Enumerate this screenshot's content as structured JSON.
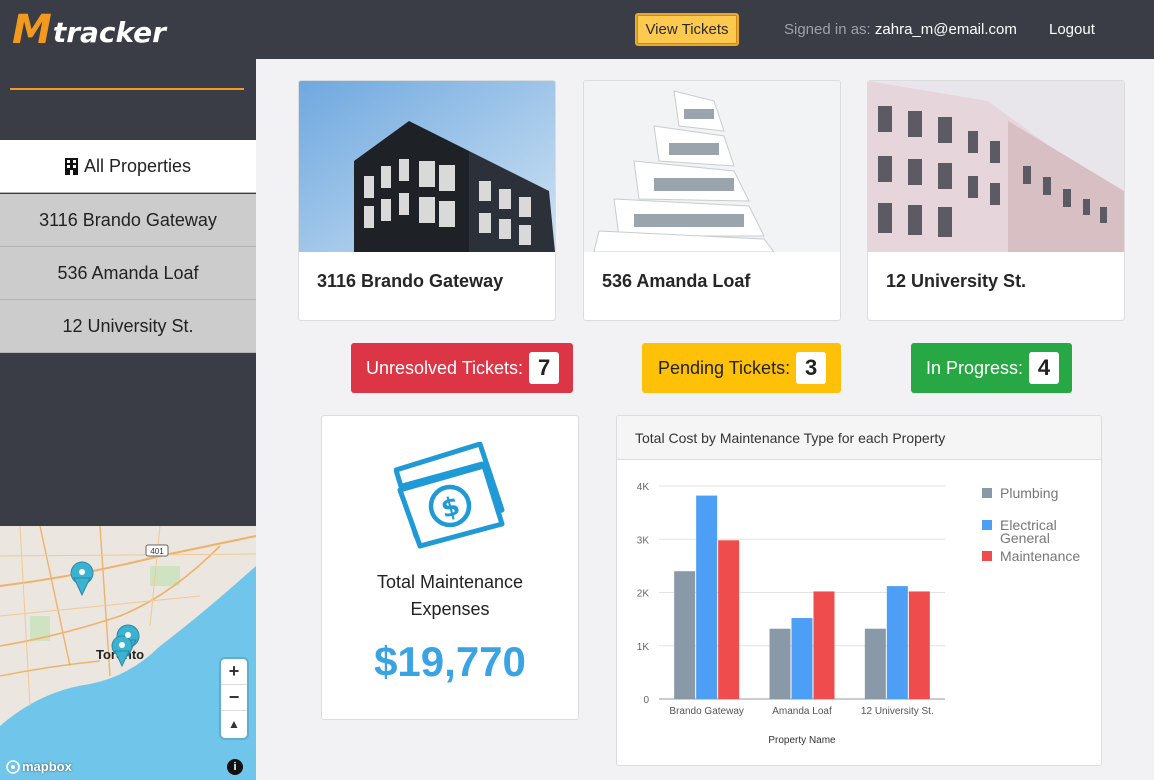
{
  "app": {
    "logo_m": "M",
    "logo_rest": "tracker",
    "view_tickets_label": "View Tickets",
    "signed_in_prefix": "Signed in as:",
    "user_email": "zahra_m@email.com",
    "logout_label": "Logout"
  },
  "sidebar": {
    "items": [
      {
        "label": "All Properties",
        "icon": "building-icon",
        "active": true
      },
      {
        "label": "3116 Brando Gateway"
      },
      {
        "label": "536 Amanda Loaf"
      },
      {
        "label": "12 University St."
      }
    ]
  },
  "map": {
    "city_label": "Toronto",
    "highway_label": "401",
    "attribution": "mapbox",
    "zoom_in": "+",
    "zoom_out": "−",
    "compass": "▲",
    "info": "i"
  },
  "properties": [
    {
      "name": "3116 Brando Gateway"
    },
    {
      "name": "536 Amanda Loaf"
    },
    {
      "name": "12 University St."
    }
  ],
  "status": {
    "unresolved_label": "Unresolved Tickets:",
    "unresolved_count": "7",
    "pending_label": "Pending Tickets:",
    "pending_count": "3",
    "inprogress_label": "In Progress:",
    "inprogress_count": "4",
    "colors": {
      "unresolved": "#dc3545",
      "pending": "#ffc107",
      "inprogress": "#28a745"
    }
  },
  "expenses": {
    "label_line1": "Total Maintenance",
    "label_line2": "Expenses",
    "value": "$19,770",
    "icon": "money-icon"
  },
  "chart_header": "Total Cost by Maintenance Type for each Property",
  "chart_data": {
    "type": "bar",
    "title": "Total Cost by Maintenance Type for each Property",
    "xlabel": "Property Name",
    "ylabel": "",
    "categories": [
      "Brando Gateway",
      "Amanda Loaf",
      "12 University St."
    ],
    "ylim": [
      0,
      4000
    ],
    "yticks": [
      "0",
      "1K",
      "2K",
      "3K",
      "4K"
    ],
    "grid": true,
    "legend_position": "right",
    "series": [
      {
        "name": "Plumbing",
        "color": "#8a99a8",
        "values": [
          2400,
          1320,
          1320
        ]
      },
      {
        "name": "Electrical",
        "color": "#4d9ff5",
        "values": [
          3820,
          1520,
          2120
        ]
      },
      {
        "name": "General Maintenance",
        "color": "#ef4d4d",
        "values": [
          2980,
          2020,
          2020
        ]
      }
    ],
    "legend_labels": [
      {
        "lines": [
          "Plumbing"
        ]
      },
      {
        "lines": [
          "Electrical",
          "General"
        ]
      },
      {
        "lines": [
          "Maintenance"
        ]
      }
    ]
  }
}
